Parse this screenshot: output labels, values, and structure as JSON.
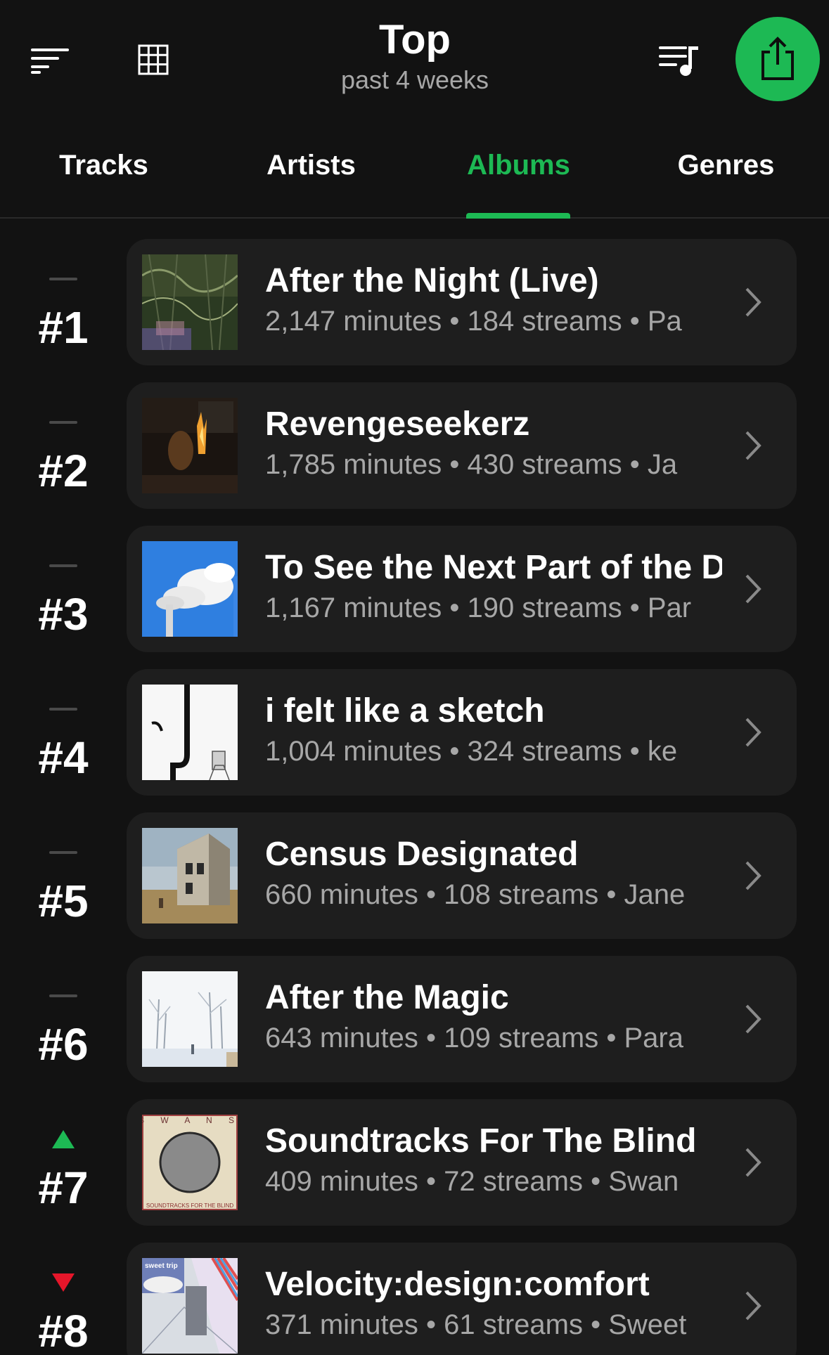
{
  "header": {
    "title": "Top",
    "subtitle": "past 4 weeks",
    "accent_color": "#1db954",
    "icons": [
      "sort-icon",
      "grid-icon",
      "queue-music-icon",
      "share-icon"
    ]
  },
  "tabs": [
    {
      "label": "Tracks",
      "active": false
    },
    {
      "label": "Artists",
      "active": false
    },
    {
      "label": "Albums",
      "active": true
    },
    {
      "label": "Genres",
      "active": false
    }
  ],
  "albums": [
    {
      "rank": "#1",
      "trend": "flat",
      "title": "After the Night (Live)",
      "meta": "2,147 minutes • 184 streams • Pa"
    },
    {
      "rank": "#2",
      "trend": "flat",
      "title": "Revengeseekerz",
      "meta": "1,785 minutes • 430 streams • Ja"
    },
    {
      "rank": "#3",
      "trend": "flat",
      "title": "To See the Next Part of the D",
      "meta": "1,167 minutes • 190 streams • Par"
    },
    {
      "rank": "#4",
      "trend": "flat",
      "title": "i felt like a sketch",
      "meta": "1,004 minutes • 324 streams • ke"
    },
    {
      "rank": "#5",
      "trend": "flat",
      "title": "Census Designated",
      "meta": "660 minutes • 108 streams • Jane"
    },
    {
      "rank": "#6",
      "trend": "flat",
      "title": "After the Magic",
      "meta": "643 minutes • 109 streams • Para"
    },
    {
      "rank": "#7",
      "trend": "up",
      "title": "Soundtracks For The Blind",
      "meta": "409 minutes • 72 streams • Swan",
      "cover_text": {
        "top": "S W A N S",
        "bottom": "SOUNDTRACKS FOR THE BLIND"
      }
    },
    {
      "rank": "#8",
      "trend": "down",
      "title": "Velocity:design:comfort",
      "meta": "371 minutes • 61 streams • Sweet",
      "cover_text": {
        "top": "sweet trip"
      }
    }
  ]
}
